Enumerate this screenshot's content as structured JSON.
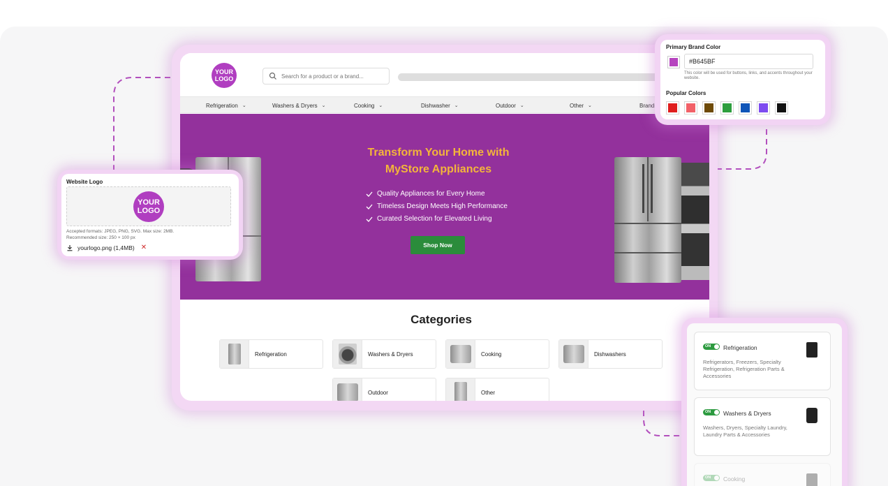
{
  "store": {
    "logo_line1": "YOUR",
    "logo_line2": "LOGO",
    "search_placeholder": "Search for a product or a brand...",
    "nav": [
      {
        "label": "Refrigeration"
      },
      {
        "label": "Washers & Dryers"
      },
      {
        "label": "Cooking"
      },
      {
        "label": "Dishwasher"
      },
      {
        "label": "Outdoor"
      },
      {
        "label": "Other"
      },
      {
        "label": "Brands"
      }
    ],
    "hero": {
      "title_line1": "Transform Your Home with",
      "title_line2": "MyStore Appliances",
      "bullets": [
        "Quality Appliances for Every Home",
        "Timeless Design Meets High Performance",
        "Curated Selection for Elevated Living"
      ],
      "cta": "Shop Now",
      "background_color": "#93319C",
      "title_color": "#F4B53A"
    },
    "categories_title": "Categories",
    "categories": [
      {
        "label": "Refrigeration"
      },
      {
        "label": "Washers & Dryers"
      },
      {
        "label": "Cooking"
      },
      {
        "label": "Dishwashers"
      },
      {
        "label": "Outdoor"
      },
      {
        "label": "Other"
      }
    ]
  },
  "brand_panel": {
    "label": "Primary Brand Color",
    "hex_value": "#B645BF",
    "hint": "This color will be used for buttons, links, and accents throughout your website.",
    "popular_label": "Popular Colors",
    "popular_colors": [
      "#E01E1E",
      "#F26168",
      "#6E4A08",
      "#2E9E3E",
      "#0F55B8",
      "#7E4CF0",
      "#111111"
    ]
  },
  "logo_panel": {
    "label": "Website Logo",
    "logo_line1": "YOUR",
    "logo_line2": "LOGO",
    "formats": "Accepted formats: JPEG, PNG, SVG. Max size: 2MB.",
    "recommended": "Recommended size: 250 × 100 px",
    "file_name": "yourlogo.png (1,4MB)",
    "remove_icon": "close-icon"
  },
  "category_panel": {
    "items": [
      {
        "toggle": "ON",
        "title": "Refrigeration",
        "desc": "Refrigerators, Freezers, Specialty Refrigeration, Refrigeration Parts & Accessories",
        "icon": "fridge-icon"
      },
      {
        "toggle": "ON",
        "title": "Washers & Dryers",
        "desc": "Washers, Dryers, Specialty Laundry, Laundry Parts & Accessories",
        "icon": "washer-icon"
      },
      {
        "toggle": "ON",
        "title": "Cooking",
        "icon": "oven-icon"
      }
    ]
  }
}
